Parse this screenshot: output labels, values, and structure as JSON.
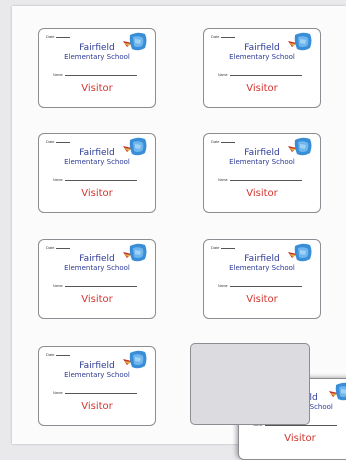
{
  "badge": {
    "date_label": "Date",
    "school_line1": "Fairfield",
    "school_line2": "Elementary School",
    "name_label": "Name",
    "role": "Visitor"
  },
  "colors": {
    "school_text": "#2d3b98",
    "visitor_text": "#d2352e",
    "logo_blue": "#3a8ed8",
    "logo_red": "#c9302c"
  },
  "icons": [
    "logo-icon"
  ]
}
